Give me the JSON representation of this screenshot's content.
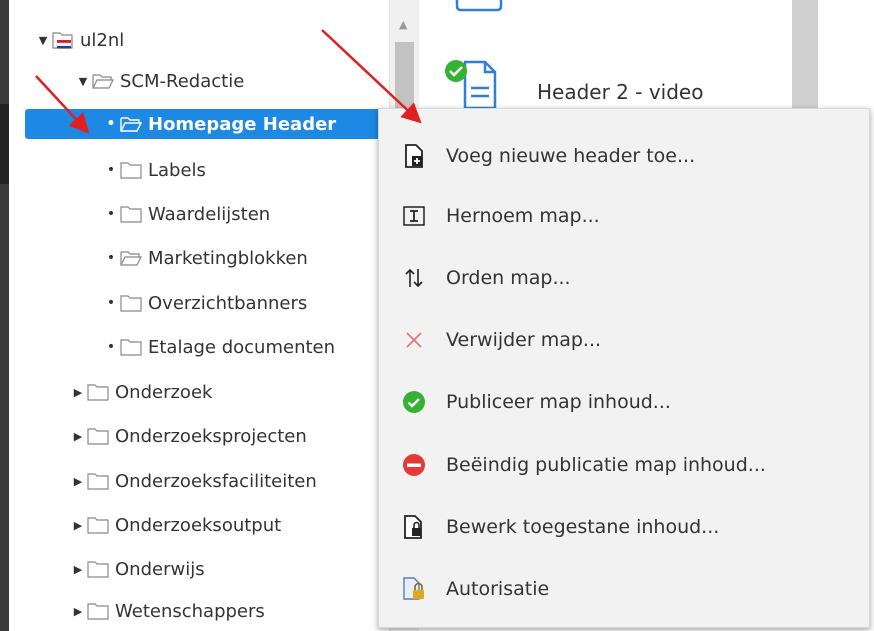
{
  "tree": {
    "items": [
      {
        "label": "ul2nl",
        "twisty": "▼"
      },
      {
        "label": "SCM-Redactie",
        "twisty": "▼"
      },
      {
        "label": "Homepage Header"
      },
      {
        "label": "Labels"
      },
      {
        "label": "Waardelijsten"
      },
      {
        "label": "Marketingblokken"
      },
      {
        "label": "Overzichtbanners"
      },
      {
        "label": "Etalage documenten"
      },
      {
        "label": "Onderzoek",
        "twisty": "▶"
      },
      {
        "label": "Onderzoeksprojecten",
        "twisty": "▶"
      },
      {
        "label": "Onderzoeksfaciliteiten",
        "twisty": "▶"
      },
      {
        "label": "Onderzoeksoutput",
        "twisty": "▶"
      },
      {
        "label": "Onderwijs",
        "twisty": "▶"
      },
      {
        "label": "Wetenschappers",
        "twisty": "▶"
      }
    ]
  },
  "document": {
    "title": "Header 2 - video"
  },
  "context_menu": {
    "items": [
      {
        "label": "Voeg nieuwe header toe...",
        "icon": "new-document-icon"
      },
      {
        "label": "Hernoem map...",
        "icon": "rename-icon"
      },
      {
        "label": "Orden map...",
        "icon": "sort-icon"
      },
      {
        "label": "Verwijder map...",
        "icon": "delete-icon"
      },
      {
        "label": "Publiceer map inhoud...",
        "icon": "publish-icon"
      },
      {
        "label": "Beëindig publicatie map inhoud...",
        "icon": "unpublish-icon"
      },
      {
        "label": "Bewerk toegestane inhoud...",
        "icon": "edit-allowed-content-icon"
      },
      {
        "label": "Autorisatie",
        "icon": "authorization-icon"
      }
    ]
  },
  "colors": {
    "selection": "#1e88e5",
    "publish": "#34b233",
    "unpublish": "#e53935",
    "delete": "#e57373",
    "arrow": "#e02020"
  }
}
